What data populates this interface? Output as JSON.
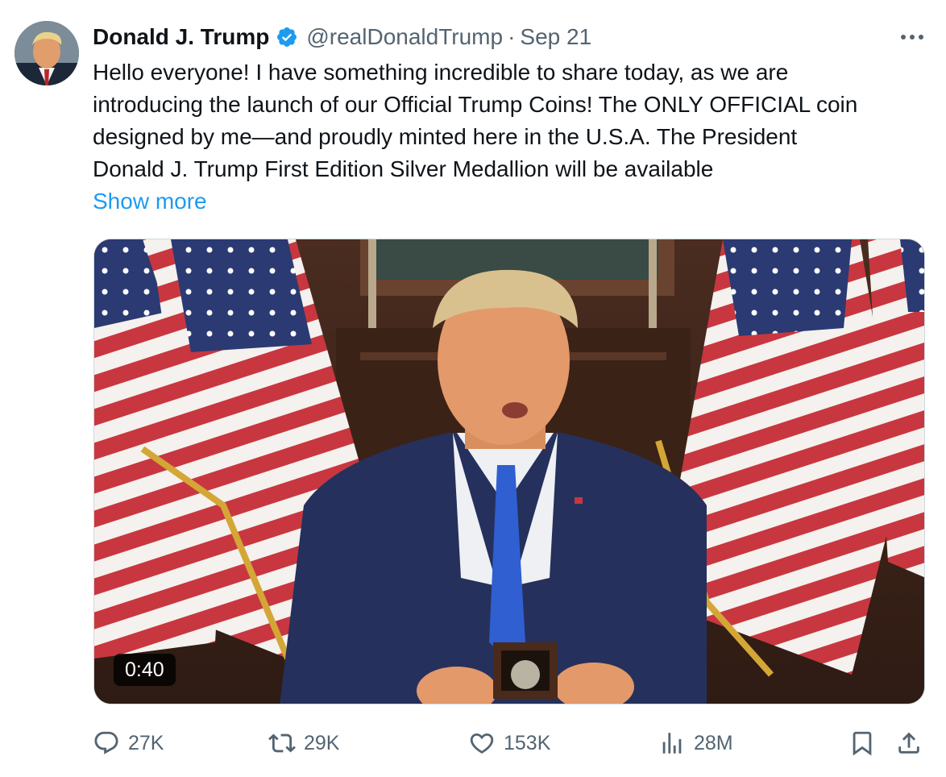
{
  "author": {
    "name": "Donald J. Trump",
    "handle": "@realDonaldTrump",
    "separator": "·",
    "date": "Sep 21",
    "verified_icon": "verified-badge-icon"
  },
  "tweet": {
    "lines": [
      "Hello everyone! I have something incredible to share today, as we are",
      "introducing the launch of our Official Trump Coins! The ONLY OFFICIAL coin",
      "designed by me—and proudly minted here in the U.S.A. The President",
      "Donald J. Trump First Edition Silver Medallion will be available"
    ],
    "show_more": "Show more"
  },
  "media": {
    "duration": "0:40"
  },
  "actions": {
    "replies": "27K",
    "reposts": "29K",
    "likes": "153K",
    "views": "28M"
  },
  "colors": {
    "text": "#0f1419",
    "secondary": "#536471",
    "link": "#1d9bf0",
    "verified": "#1d9bf0"
  }
}
